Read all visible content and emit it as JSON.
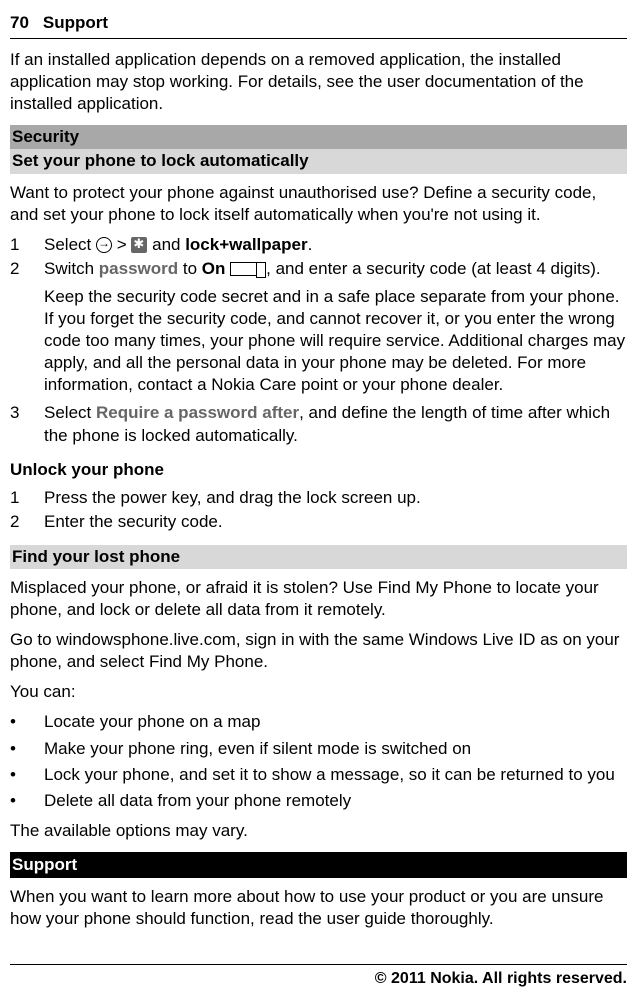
{
  "header": {
    "page_number": "70",
    "section_name": "Support"
  },
  "intro": "If an installed application depends on a removed application, the installed application may stop working. For details, see the user documentation of the installed application.",
  "security": {
    "heading": "Security",
    "auto_lock": {
      "title": "Set your phone to lock automatically",
      "intro": "Want to protect your phone against unauthorised use? Define a security code, and set your phone to lock itself automatically when you're not using it.",
      "step1": {
        "num": "1",
        "pre": "Select ",
        "gt": " > ",
        "post": " and ",
        "bold": "lock+wallpaper",
        "end": "."
      },
      "step2": {
        "num": "2",
        "a": "Switch ",
        "password": "password",
        "b": " to ",
        "on": "On",
        "c": " ",
        "d": ", and enter a security code (at least 4 digits)."
      },
      "note": "Keep the security code secret and in a safe place separate from your phone. If you forget the security code, and cannot recover it, or you enter the wrong code too many times, your phone will require service. Additional charges may apply, and all the personal data in your phone may be deleted. For more information, contact a Nokia Care point or your phone dealer.",
      "step3": {
        "num": "3",
        "a": "Select ",
        "bold": "Require a password after",
        "b": ", and define the length of time after which the phone is locked automatically."
      }
    },
    "unlock": {
      "title": "Unlock your phone",
      "s1": {
        "num": "1",
        "text": "Press the power key, and drag the lock screen up."
      },
      "s2": {
        "num": "2",
        "text": "Enter the security code."
      }
    },
    "find": {
      "title": "Find your lost phone",
      "p1": "Misplaced your phone, or afraid it is stolen? Use Find My Phone to locate your phone, and lock or delete all data from it remotely.",
      "p2": "Go to windowsphone.live.com, sign in with the same Windows Live ID as on your phone, and select Find My Phone.",
      "p3": "You can:",
      "b1": "Locate your phone on a map",
      "b2": "Make your phone ring, even if silent mode is switched on",
      "b3": "Lock your phone, and set it to show a message, so it can be returned to you",
      "b4": "Delete all data from your phone remotely",
      "p4": "The available options may vary."
    }
  },
  "support": {
    "heading": "Support",
    "p": "When you want to learn more about how to use your product or you are unsure how your phone should function, read the user guide thoroughly."
  },
  "footer": "© 2011 Nokia. All rights reserved."
}
